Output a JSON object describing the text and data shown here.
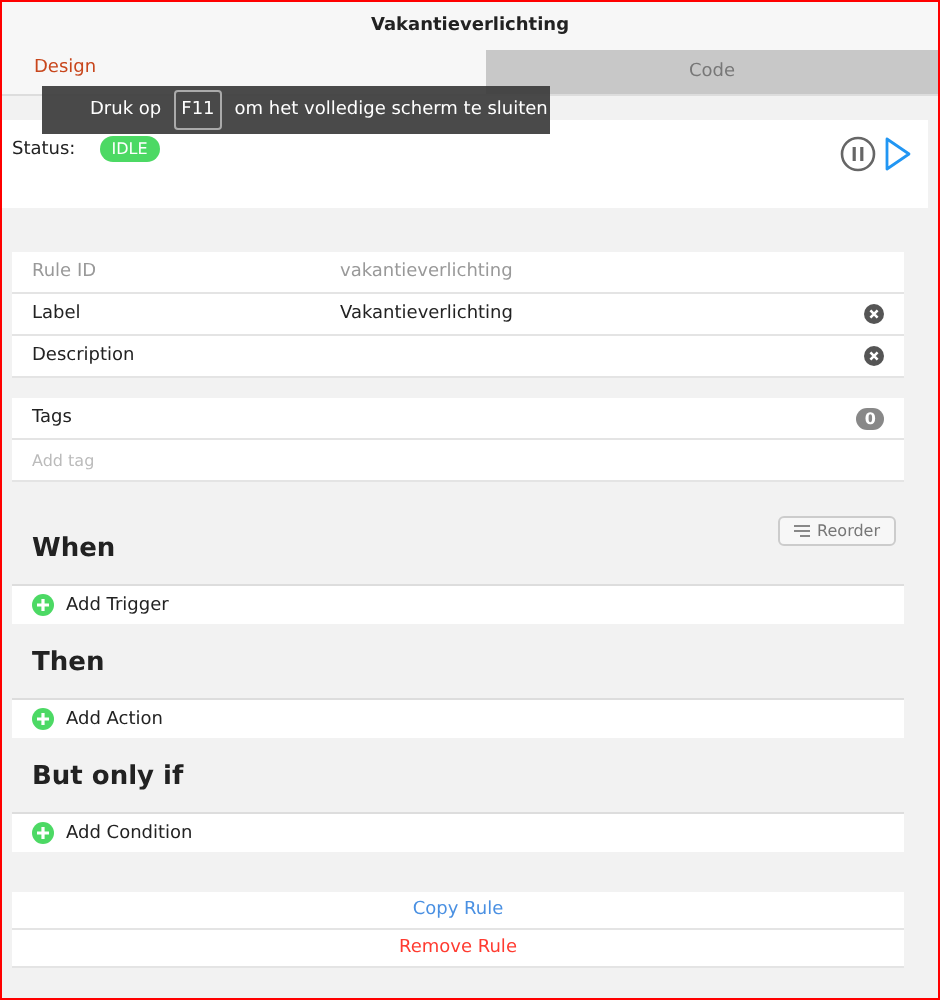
{
  "window": {
    "title": "Vakantieverlichting"
  },
  "tabs": [
    {
      "label": "Design",
      "selected": true
    },
    {
      "label": "Code",
      "selected": false
    }
  ],
  "fullscreen_notice": {
    "before": "Druk op",
    "key": "F11",
    "after": "om het volledige scherm te sluiten"
  },
  "status": {
    "label": "Status:",
    "badge": "IDLE",
    "color": "#4cd964"
  },
  "fields": [
    {
      "label": "Rule ID",
      "value": "vakantieverlichting",
      "clearable": false,
      "disabled": true
    },
    {
      "label": "Label",
      "value": "Vakantieverlichting",
      "clearable": true,
      "disabled": false
    },
    {
      "label": "Description",
      "clearable": true,
      "disabled": false
    }
  ],
  "tags": {
    "label": "Tags",
    "count": "0",
    "placeholder": "Add tag"
  },
  "reorder_button": "Reorder",
  "sections": [
    {
      "heading": "When",
      "add": "Add Trigger"
    },
    {
      "heading": "Then",
      "add": "Add Action"
    },
    {
      "heading": "But only if",
      "add": "Add Condition"
    }
  ],
  "actions": [
    {
      "label": "Copy Rule",
      "kind": "normal"
    },
    {
      "label": "Remove Rule",
      "kind": "danger"
    }
  ]
}
